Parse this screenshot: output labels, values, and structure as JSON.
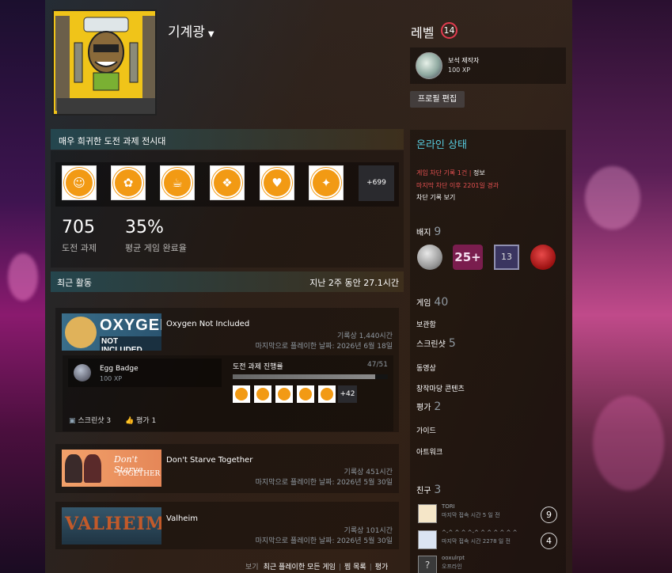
{
  "profile": {
    "name": "기계광",
    "level_label": "레벨",
    "level": "14"
  },
  "featured_badge": {
    "name": "보석 제작자",
    "xp": "100 XP"
  },
  "edit_profile_label": "프로필 편집",
  "achievement_showcase": {
    "title": "매우 희귀한 도전 과제 전시대",
    "more": "+699",
    "stats": [
      {
        "value": "705",
        "label": "도전 과제"
      },
      {
        "value": "35%",
        "label": "평균 게임 완료율"
      }
    ]
  },
  "recent_activity": {
    "title": "최근 활동",
    "summary": "지난 2주 동안 27.1시간",
    "games": [
      {
        "title": "Oxygen Not Included",
        "hours": "기록상 1,440시간",
        "last_played": "마지막으로 플레이한 날짜: 2026년 6월 18일",
        "capsule_text": [
          "OXYGEN",
          "NOT INCLUDED"
        ],
        "badge": {
          "name": "Egg Badge",
          "xp": "100 XP"
        },
        "progress_label": "도전 과제 진행률",
        "progress_count": "47/51",
        "progress": 0.92,
        "more_achievements": "+42",
        "screenshots": "스크린샷 3",
        "reviews": "평가 1"
      },
      {
        "title": "Don't Starve Together",
        "hours": "기록상 451시간",
        "last_played": "마지막으로 플레이한 날짜: 2026년 5월 30일",
        "capsule_text": [
          "Don't Starve",
          "TOGETHER"
        ]
      },
      {
        "title": "Valheim",
        "hours": "기록상 101시간",
        "last_played": "마지막으로 플레이한 날짜: 2026년 5월 30일",
        "capsule_text": [
          "VALHEIM"
        ]
      }
    ],
    "footer": {
      "view": "보기",
      "all_recent": "최근 플레이한 모든 게임",
      "wishlist": "찜 목록",
      "reviews": "평가"
    }
  },
  "sidebar": {
    "status": "온라인 상태",
    "ban_line1": "게임 차단 기록 1건 |",
    "ban_info": "정보",
    "ban_line2": "마지막 차단 이후 2201일 경과",
    "ban_link": "차단 기록 보기",
    "badges": {
      "label": "배지",
      "count": "9"
    },
    "games": {
      "label": "게임",
      "count": "40"
    },
    "inventory": "보관함",
    "screenshots": {
      "label": "스크린샷",
      "count": "5"
    },
    "videos": "동영상",
    "workshop": "창작마당 콘텐츠",
    "reviews": {
      "label": "평가",
      "count": "2"
    },
    "guides": "가이드",
    "artwork": "아트워크",
    "friends": {
      "label": "친구",
      "count": "3",
      "list": [
        {
          "name": "TORI",
          "sub": "마지막 접속 시간 5 일 전",
          "level": "9"
        },
        {
          "name": "^-^ ^ ^ ^-^ ^ ^ ^ ^ ^ ^",
          "sub": "마지막 접속 시간 2278 일 전",
          "level": "4"
        },
        {
          "name": "ooxulrpt",
          "sub": "오프라인",
          "level": ""
        }
      ]
    }
  },
  "colors": {
    "accent_blue": "#57cbde",
    "level_red": "#e23b4f",
    "achievement_orange": "#f29a14",
    "ban_red": "#e45050"
  }
}
